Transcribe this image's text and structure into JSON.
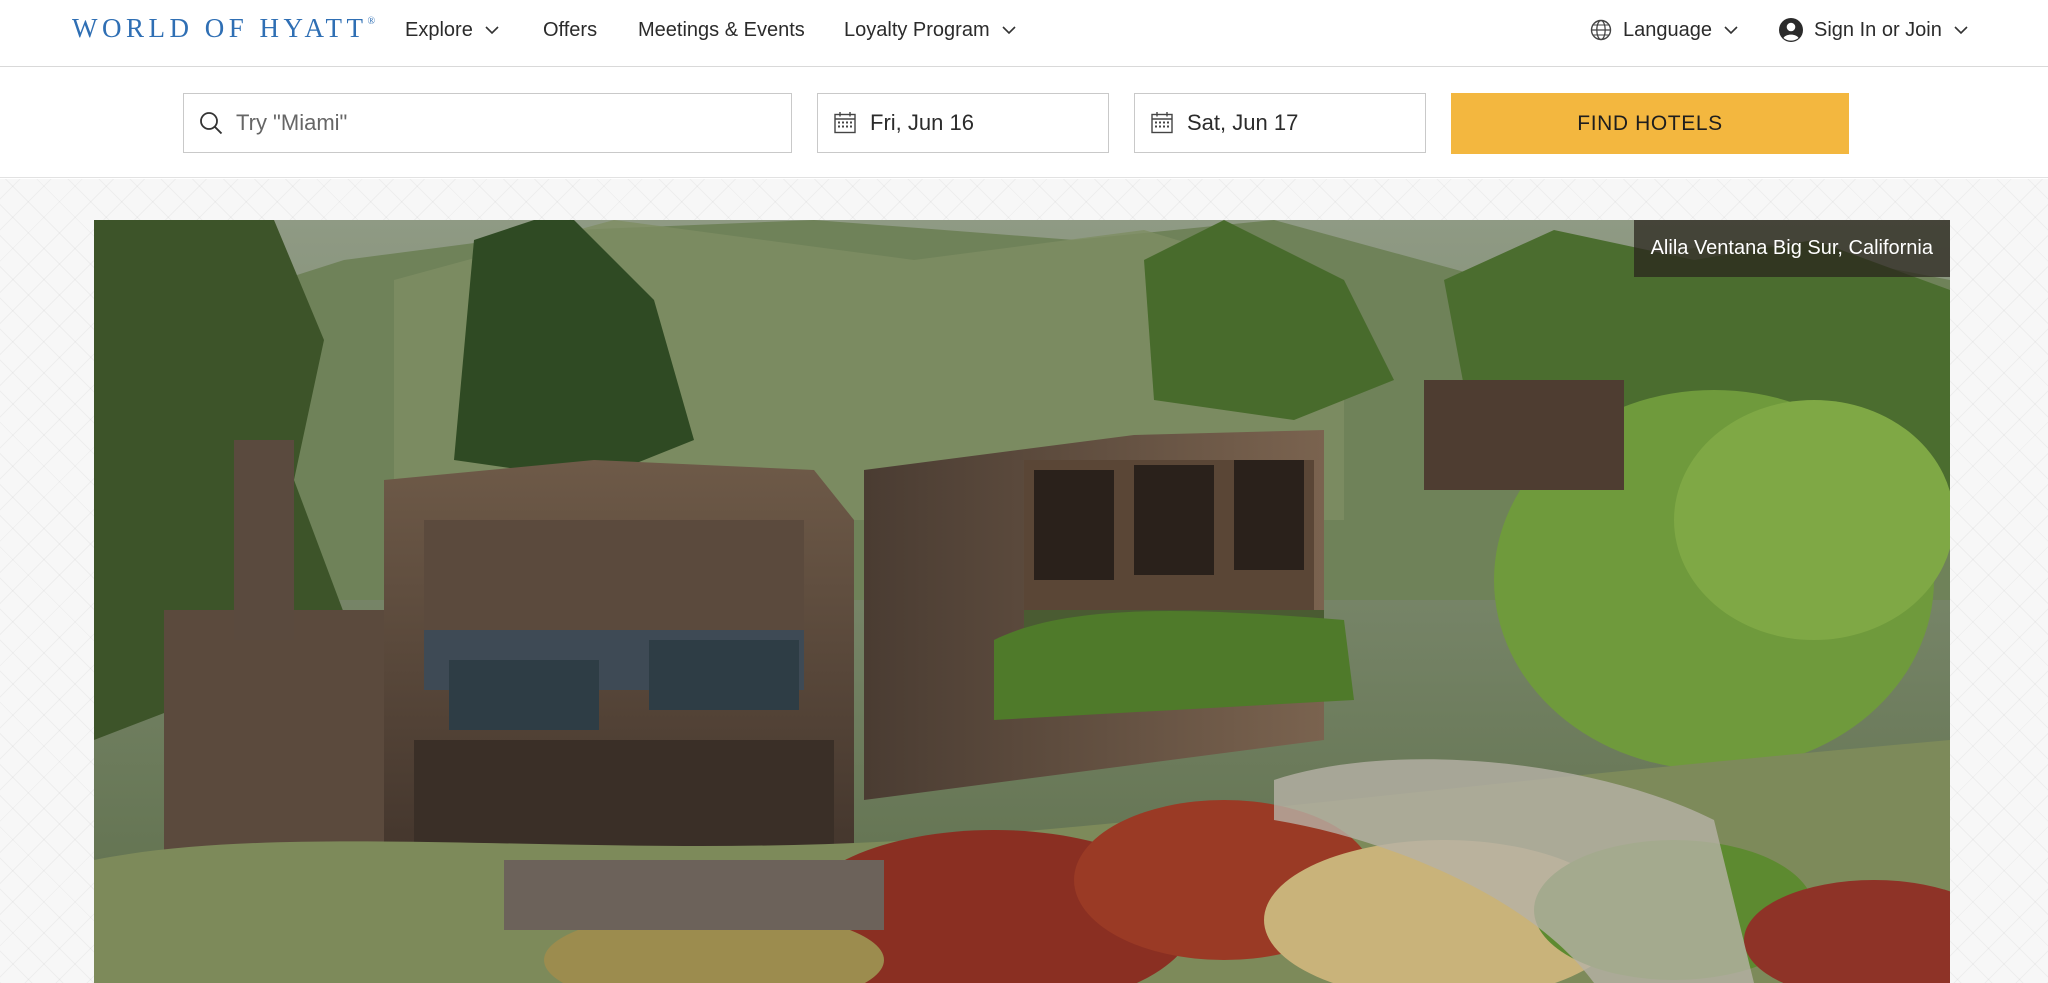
{
  "brand": {
    "logo_text": "WORLD OF HYATT",
    "logo_mark": "®",
    "brand_color": "#2f6fb4"
  },
  "nav": {
    "explore": "Explore",
    "offers": "Offers",
    "meetings": "Meetings & Events",
    "loyalty": "Loyalty Program",
    "language": "Language",
    "signin": "Sign In or Join"
  },
  "search": {
    "destination_placeholder": "Try \"Miami\"",
    "checkin": "Fri, Jun 16",
    "checkout": "Sat, Jun 17",
    "find_label": "FIND HOTELS",
    "button_color": "#f3b73f"
  },
  "hero": {
    "caption": "Alila Ventana Big Sur, California"
  },
  "icons": {
    "search": "search-icon",
    "calendar": "calendar-icon",
    "globe": "globe-icon",
    "user": "user-icon",
    "chevron": "chevron-down-icon"
  }
}
